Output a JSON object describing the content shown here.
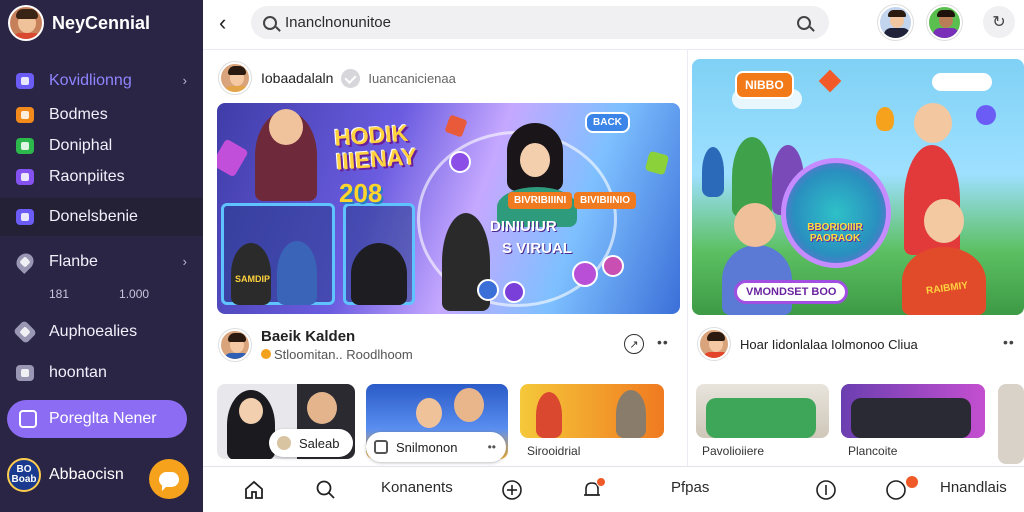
{
  "sidebar": {
    "brand": "NeyCennial",
    "items": [
      {
        "label": "Kovidlionng",
        "color": "#6b5cf6"
      },
      {
        "label": "Bodmes",
        "color": "#f28a1c"
      },
      {
        "label": "Doniphal",
        "color": "#2db84d"
      },
      {
        "label": "Raonpiites",
        "color": "#8452f0"
      },
      {
        "label": "Donelsbenie",
        "color": "#6b5cf6"
      },
      {
        "label": "Flanbe",
        "color": "#9a97b4"
      },
      {
        "label": "Auphoealies",
        "color": "#9a97b4"
      },
      {
        "label": "hoontan",
        "color": "#9a97b4"
      }
    ],
    "sub_values": [
      "181",
      "1.000"
    ],
    "cta_label": "Poreglta Nener",
    "profile_name": "Abbaocisn",
    "profile_badge": "BO Boab"
  },
  "topbar": {
    "search_value": "Inanclnonunitoe"
  },
  "posts": {
    "left": {
      "author": "Iobaadalaln",
      "tag": "Iuancanicienaa",
      "hero_title_line1": "HODIK",
      "hero_title_line2": "IIIENAY",
      "hero_number": "208",
      "hero_sub_line1": "DINIUIUR",
      "hero_sub_line2": "S VIRUAL",
      "pill_top": "BACK",
      "pill_a": "BIVRIBIIINI",
      "pill_b": "BIVIBIINIO",
      "shirt_text": "SAMDIP"
    },
    "right": {
      "badge": "NIBBO",
      "circle_text": "BBORIOIIIR PAORAOK",
      "bottom_pill": "VMONDSET BOO",
      "shirt_text": "RAIBMIY"
    },
    "second_left": {
      "name": "Baeik Kalden",
      "meta": "Stloomitan.. Roodlhoom"
    },
    "second_right": {
      "name": "Hoar Iidonlalaa Iolmonoo Cliua"
    }
  },
  "thumbs": [
    {
      "chip": "Saleab"
    },
    {
      "chip": "Snilmonon"
    },
    {
      "label": "Sirooidrial"
    },
    {
      "label": "Pavolioiiere"
    },
    {
      "label": "Plancoite"
    }
  ],
  "bottombar": {
    "item_text_1": "Konanents",
    "item_text_2": "Pfpas",
    "item_text_3": "Hnandlais"
  }
}
